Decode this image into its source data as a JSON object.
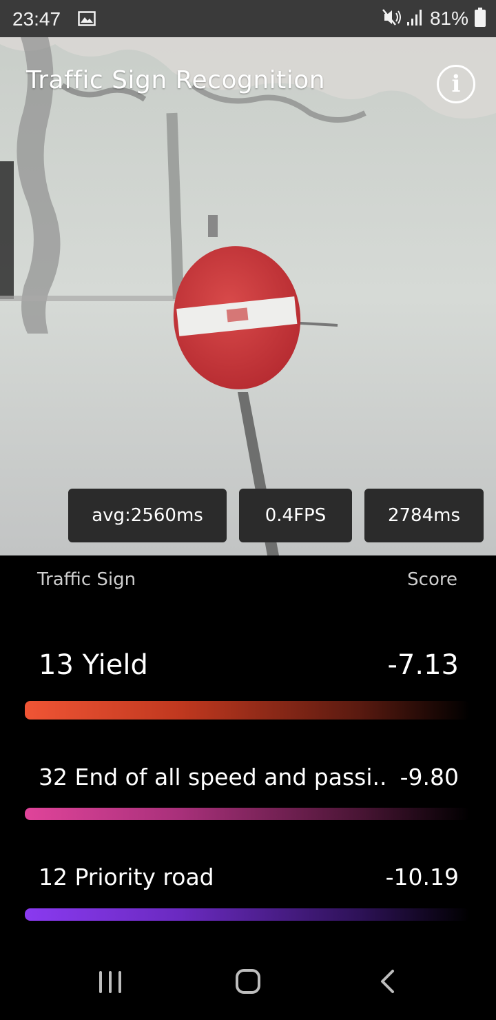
{
  "status_bar": {
    "time": "23:47",
    "battery": "81%",
    "icons": [
      "gallery-icon",
      "mute-icon",
      "signal-icon",
      "battery-icon"
    ]
  },
  "app": {
    "title": "Traffic Sign Recognition",
    "info_icon": "i"
  },
  "stats": {
    "avg": "avg:2560ms",
    "fps": "0.4FPS",
    "latency": "2784ms"
  },
  "results": {
    "header_left": "Traffic Sign",
    "header_right": "Score",
    "rows": [
      {
        "label": "13 Yield",
        "score": "-7.13",
        "color": "#f05535"
      },
      {
        "label": "32  End of all speed and passi..",
        "score": "-9.80",
        "color": "#e0449a"
      },
      {
        "label": "12  Priority road",
        "score": "-10.19",
        "color": "#8a3af0"
      }
    ]
  },
  "nav": {
    "icons": [
      "recent-apps-icon",
      "home-icon",
      "back-icon"
    ]
  }
}
